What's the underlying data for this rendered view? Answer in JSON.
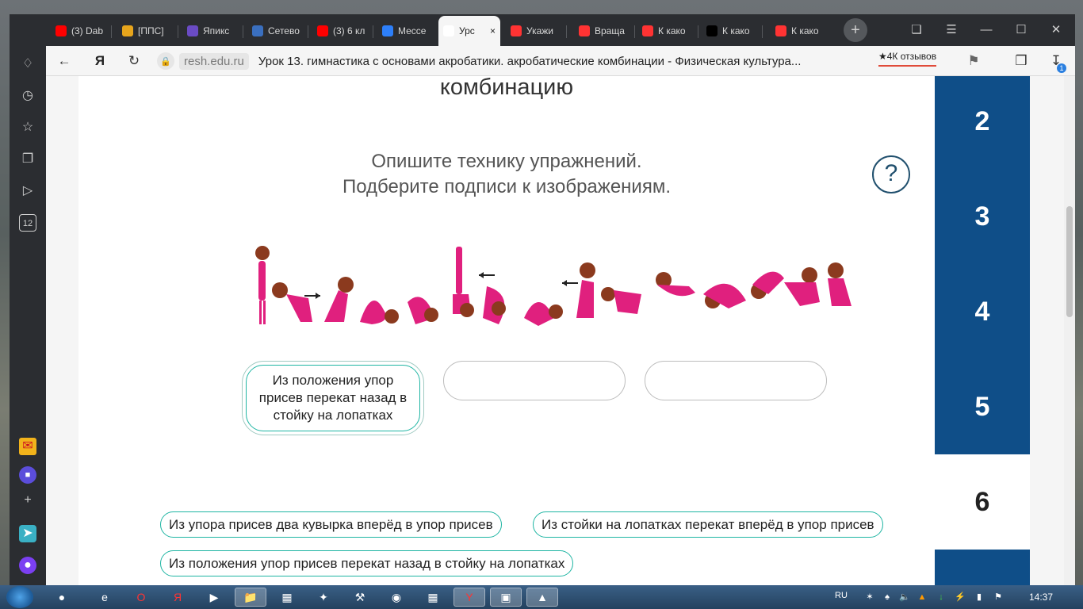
{
  "tabs": [
    {
      "label": "(3) Dab",
      "icon": "youtube-icon",
      "color": "#ff0000"
    },
    {
      "label": "[ППС]",
      "icon": "pps-icon",
      "color": "#e7a51c"
    },
    {
      "label": "Япикс",
      "icon": "yandex-icon",
      "color": "#6a4bc4"
    },
    {
      "label": "Сетево",
      "icon": "site-icon",
      "color": "#3a6fbf"
    },
    {
      "label": "(3) 6 кл",
      "icon": "youtube-icon",
      "color": "#ff0000"
    },
    {
      "label": "Мессе",
      "icon": "messenger-icon",
      "color": "#2d7ff9"
    },
    {
      "label": "Урс",
      "icon": "resh-icon",
      "color": "#ffffff",
      "active": true
    },
    {
      "label": "Укажи",
      "icon": "yandex-icon",
      "color": "#ff3333"
    },
    {
      "label": "Враща",
      "icon": "yandex-icon",
      "color": "#ff3333"
    },
    {
      "label": "К како",
      "icon": "yandex-icon",
      "color": "#ff3333"
    },
    {
      "label": "К како",
      "icon": "z-icon",
      "color": "#000000"
    },
    {
      "label": "К како",
      "icon": "yandex-icon",
      "color": "#ff3333"
    }
  ],
  "address": {
    "domain": "resh.edu.ru",
    "title": "Урок 13. гимнастика с основами акробатики. акробатические комбинации - Физическая культура...",
    "reviews": "★4К отзывов",
    "download_count": "1"
  },
  "page": {
    "heading": "комбинацию",
    "instruction_line1": "Опишите технику упражнений.",
    "instruction_line2": "Подберите подписи к изображениям.",
    "help": "?",
    "slots": [
      {
        "text": "Из положения упор присев перекат назад в стойку на лопатках"
      },
      {
        "text": ""
      },
      {
        "text": ""
      }
    ],
    "options": [
      "Из упора присев два кувырка вперёд в упор присев",
      "Из стойки на лопатках перекат вперёд в упор присев",
      "Из положения упор присев перекат назад в стойку на лопатках"
    ]
  },
  "task_nav": [
    "2",
    "3",
    "4",
    "5",
    "6"
  ],
  "current_task": "6",
  "taskbar": {
    "lang": "RU",
    "time": "14:37"
  },
  "colors": {
    "accent": "#1fb5a3",
    "nav_blue": "#0f4e88",
    "figure_pink": "#e0207e",
    "hair_brown": "#8b3a1e"
  }
}
